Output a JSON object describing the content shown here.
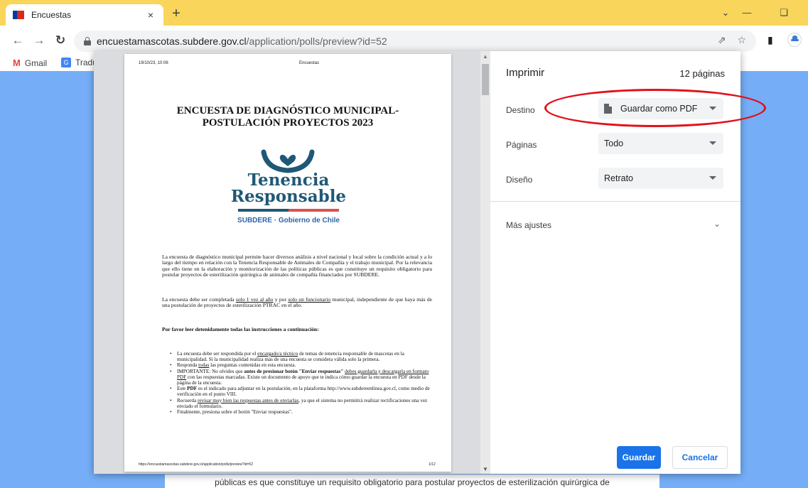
{
  "browser": {
    "tab_title": "Encuestas",
    "tab_close": "×",
    "new_tab": "+",
    "url_domain": "encuestamascotas.subdere.gov.cl",
    "url_path": "/application/polls/preview?id=52",
    "bookmarks": [
      {
        "label": "Gmail",
        "icon": "gmail-icon"
      },
      {
        "label": "Tradu",
        "icon": "translate-icon"
      }
    ]
  },
  "page_behind": {
    "visible_text": "públicas es que constituye un requisito obligatorio para postular proyectos de esterilización quirúrgica de"
  },
  "preview": {
    "header_date": "19/10/23, 10:06",
    "header_title": "Encuestas",
    "doc_title_line1": "ENCUESTA DE DIAGNÓSTICO MUNICIPAL-",
    "doc_title_line2": "POSTULACIÓN PROYECTOS 2023",
    "logo_line1": "Tenencia",
    "logo_line2": "Responsable",
    "logo_sub": "SUBDERE · Gobierno de Chile",
    "para1": "La encuesta de diagnóstico municipal permite hacer diversos análisis a nivel nacional y local sobre la condición actual y a lo largo del tiempo en relación con la Tenencia Responsable de Animales de Compañía y el trabajo municipal. Por la relevancia que ello tiene en la elaboración y monitorización de las políticas públicas es que constituye un requisito obligatorio para postular proyectos de esterilización quirúrgica de animales de compañía financiados por SUBDERE.",
    "para2_a": "La encuesta debe ser completada ",
    "para2_u1": "solo 1 vez al año",
    "para2_b": " y por ",
    "para2_u2": "solo un funcionario",
    "para2_c": " municipal, independiente de que haya más de una postulación de proyectos de esterilización PTRAC en el año.",
    "para3": "Por favor leer detenidamente todas las instrucciones a continuación:",
    "bullet1_a": "La encuesta debe ser respondida por el ",
    "bullet1_u": "encargado/a técnico",
    "bullet1_b": " de temas de tenencia responsable de mascotas en la municipalidad. Si la municipalidad realiza más de una encuesta se considera válida solo la primera.",
    "bullet2_a": "Responda ",
    "bullet2_u": "todas",
    "bullet2_b": " las preguntas contenidas en esta encuesta.",
    "bullet3_a": "IMPORTANTE: No olvides que ",
    "bullet3_bold": "antes de presionar botón \"Enviar respuestas\"",
    "bullet3_u1": "debes guardarla y descargarla en formato PDF",
    "bullet3_b": " con las respuestas marcadas. Existe un documento de apoyo que te indica cómo guardar la encuesta en PDF desde la página de la encuesta.",
    "bullet4_a": "Este ",
    "bullet4_bold": "PDF",
    "bullet4_b": " es el indicado para adjuntar en la postulación, en la plataforma http://www.subdereenlinea.gov.cl, como medio de verificación en el punto VIII.",
    "bullet5_a": "Recuerda ",
    "bullet5_u": "revisar muy bien las respuestas antes de enviarlas",
    "bullet5_b": ", ya que el sistema no permitirá realizar rectificaciones una vez enviado el formulario.",
    "bullet6": "Finalmente, presiona sobre el botón \"Enviar respuestas\".",
    "footer_url": "https://encuestamascotas.subdere.gov.cl/application/polls/preview?id=52",
    "footer_page": "1/12"
  },
  "print_settings": {
    "title": "Imprimir",
    "page_count": "12 páginas",
    "destination_label": "Destino",
    "destination_value": "Guardar como PDF",
    "pages_label": "Páginas",
    "pages_value": "Todo",
    "layout_label": "Diseño",
    "layout_value": "Retrato",
    "more_settings_label": "Más ajustes",
    "save_button": "Guardar",
    "cancel_button": "Cancelar"
  },
  "colors": {
    "tabstrip": "#f9d65b",
    "page_background": "#75aef7",
    "primary_button": "#1a73e8",
    "annotation": "#e0121b",
    "logo_text": "#1f5876"
  }
}
